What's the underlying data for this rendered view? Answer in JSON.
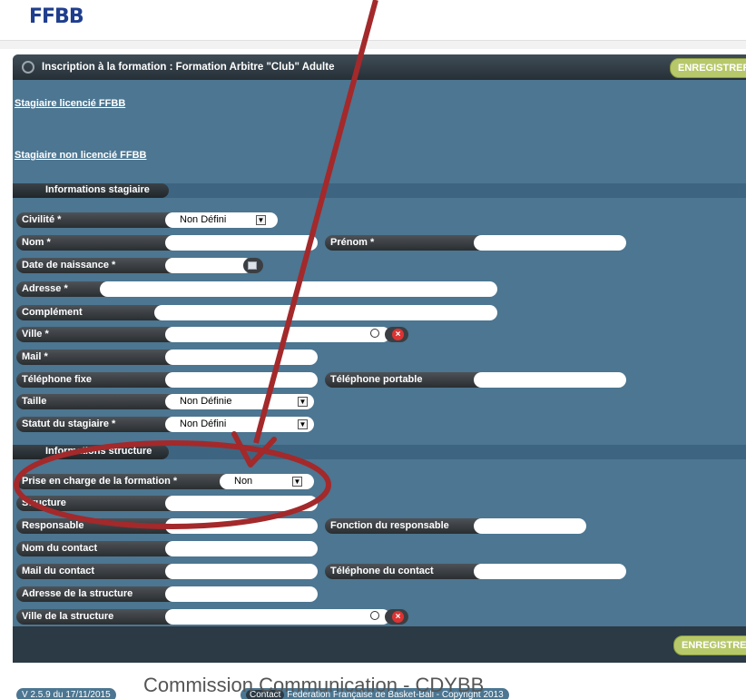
{
  "header": {
    "logo": "FFBB"
  },
  "panel": {
    "title": "Inscription à la formation : Formation Arbitre \"Club\" Adulte",
    "save_label": "ENREGISTRER"
  },
  "links": {
    "licensed": "Stagiaire licencié FFBB",
    "unlicensed": "Stagiaire non licencié FFBB"
  },
  "sections": {
    "trainee": "Informations stagiaire",
    "structure": "Informations structure"
  },
  "trainee_fields": {
    "civilite": {
      "label": "Civilité *",
      "value": "Non Défini"
    },
    "nom": {
      "label": "Nom *",
      "value": ""
    },
    "prenom": {
      "label": "Prénom *",
      "value": ""
    },
    "naissance": {
      "label": "Date de naissance *",
      "value": ""
    },
    "adresse": {
      "label": "Adresse *",
      "value": ""
    },
    "complement": {
      "label": "Complément",
      "value": ""
    },
    "ville": {
      "label": "Ville *",
      "value": ""
    },
    "mail": {
      "label": "Mail *",
      "value": ""
    },
    "tel_fixe": {
      "label": "Téléphone fixe",
      "value": ""
    },
    "tel_portable": {
      "label": "Téléphone portable",
      "value": ""
    },
    "taille": {
      "label": "Taille",
      "value": "Non Définie"
    },
    "statut": {
      "label": "Statut du stagiaire *",
      "value": "Non Défini"
    }
  },
  "structure_fields": {
    "prise_en_charge": {
      "label": "Prise en charge de la formation *",
      "value": "Non"
    },
    "structure": {
      "label": "Structure",
      "value": ""
    },
    "responsable": {
      "label": "Responsable",
      "value": ""
    },
    "fonction_responsable": {
      "label": "Fonction du responsable",
      "value": ""
    },
    "nom_contact": {
      "label": "Nom du contact",
      "value": ""
    },
    "mail_contact": {
      "label": "Mail du contact",
      "value": ""
    },
    "tel_contact": {
      "label": "Téléphone du contact",
      "value": ""
    },
    "adresse_structure": {
      "label": "Adresse de la structure",
      "value": ""
    },
    "ville_structure": {
      "label": "Ville de la structure",
      "value": ""
    }
  },
  "footer": {
    "version": "V 2.5.9 du 17/11/2015",
    "contact_label": "Contact",
    "copyright": "Federation Française de Basket-Ball - Copyright 2013",
    "overlay_text": "Commission Communication - CDYBB"
  },
  "annotation_color": "#a3292b"
}
